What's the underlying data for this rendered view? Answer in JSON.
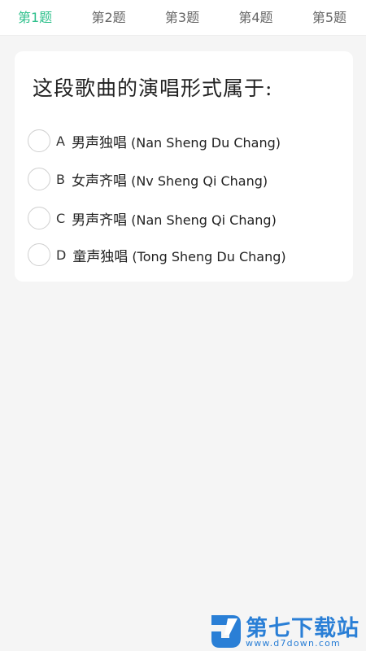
{
  "tabs": [
    {
      "label": "第1题",
      "active": true
    },
    {
      "label": "第2题",
      "active": false
    },
    {
      "label": "第3题",
      "active": false
    },
    {
      "label": "第4题",
      "active": false
    },
    {
      "label": "第5题",
      "active": false
    }
  ],
  "question": {
    "text": "这段歌曲的演唱形式属于:",
    "options": [
      {
        "letter": "A",
        "text": "男声独唱",
        "pinyin": " (Nan Sheng Du Chang)"
      },
      {
        "letter": "B",
        "text": "女声齐唱",
        "pinyin": " (Nv Sheng Qi Chang)"
      },
      {
        "letter": "C",
        "text": "男声齐唱",
        "pinyin": " (Nan Sheng Qi Chang)"
      },
      {
        "letter": "D",
        "text": "童声独唱",
        "pinyin": " (Tong Sheng Du Chang)"
      }
    ]
  },
  "watermark": {
    "brand": "第七下载站",
    "url": "www.d7down.com"
  },
  "colors": {
    "accent": "#2fc08c",
    "tab_inactive": "#666666",
    "background": "#f5f5f5",
    "watermark": "#2a7fd6"
  }
}
